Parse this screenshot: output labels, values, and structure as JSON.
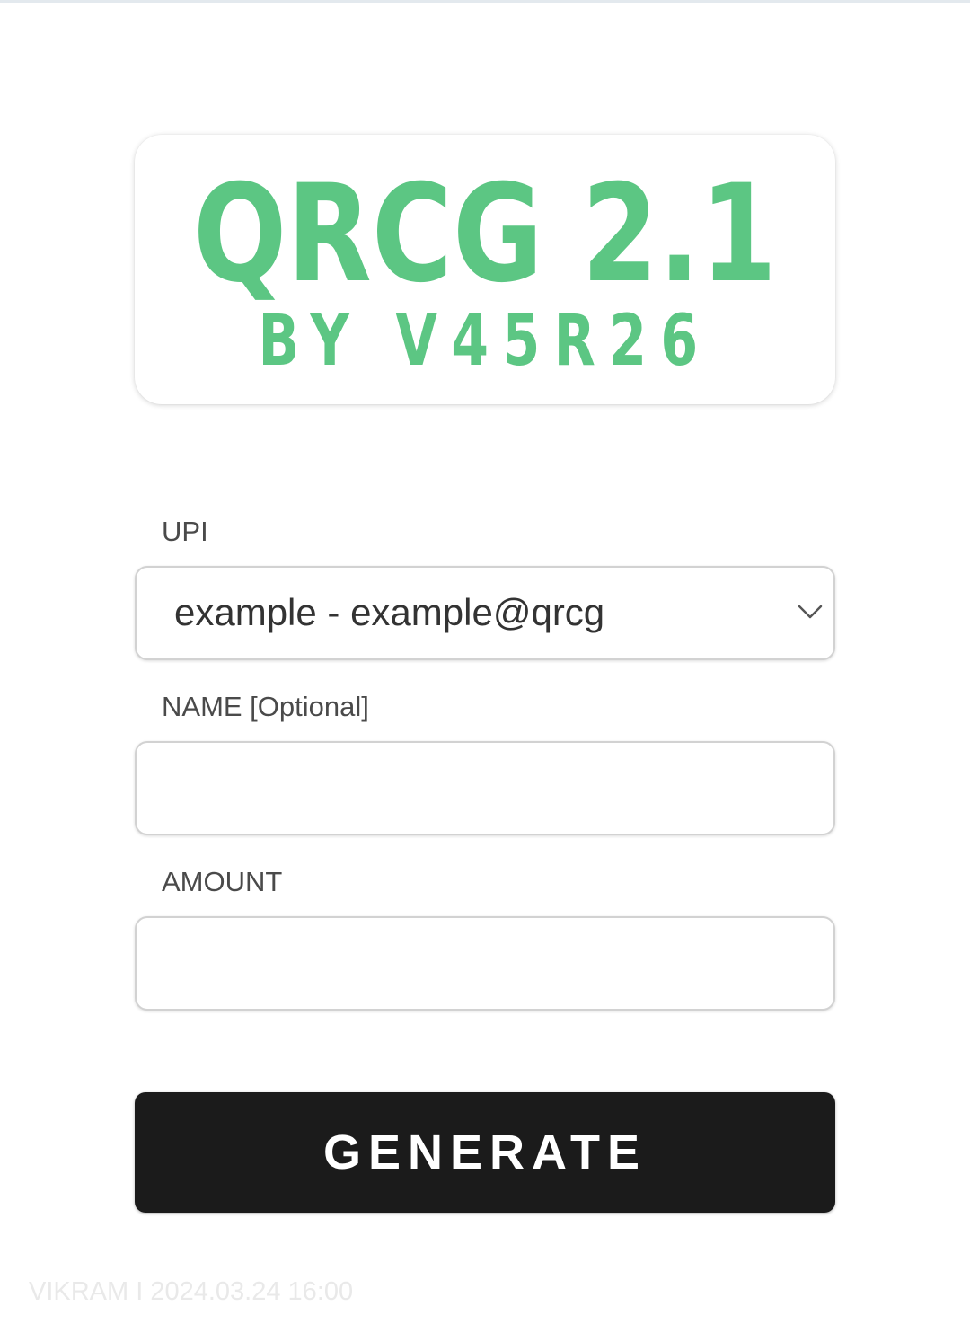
{
  "logo": {
    "title": "QRCG 2.1",
    "subtitle": "BY V45R26",
    "color": "#5cc683"
  },
  "form": {
    "upi": {
      "label": "UPI",
      "selected": "example - example@qrcg",
      "icon": "chevron-down-icon"
    },
    "name": {
      "label": "NAME [Optional]",
      "value": ""
    },
    "amount": {
      "label": "AMOUNT",
      "value": ""
    },
    "generate": {
      "label": "GENERATE",
      "color": "#1b1b1b"
    }
  },
  "watermark": {
    "text": "VIKRAM  I 2024.03.24 16:00"
  }
}
